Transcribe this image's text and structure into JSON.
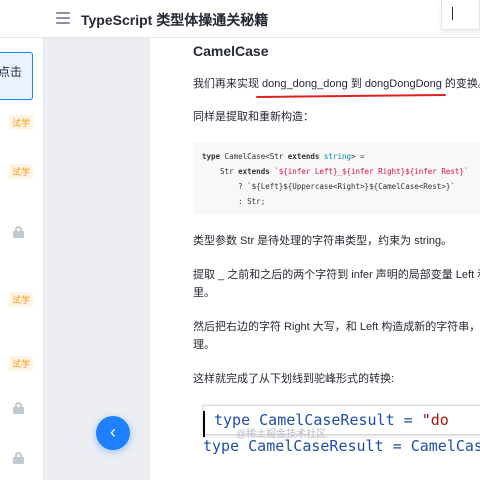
{
  "header": {
    "title": "TypeScript 类型体操通关秘籍"
  },
  "sidebar": {
    "active_item_label": "可点击",
    "badges": [
      "试学",
      "试学",
      "试学",
      "试学"
    ]
  },
  "article": {
    "heading": "CamelCase",
    "para1": "我们再来实现 dong_dong_dong 到 dongDongDong 的变换。",
    "para2": "同样是提取和重新构造：",
    "code_lines": {
      "l1_kw": "type",
      "l1_rest": " CamelCase<Str ",
      "l1_kw2": "extends",
      "l1_ty": " string",
      "l1_end": "> =",
      "l2_pre": "    Str ",
      "l2_kw": "extends",
      "l2_str": " `${infer Left}_${infer Right}${infer Rest}`",
      "l3": "        ? `${Left}${Uppercase<Right>}${CamelCase<Rest>}`",
      "l4": "        : Str;"
    },
    "para3": "类型参数 Str 是待处理的字符串类型，约束为 string。",
    "para4a": "提取 _ 之前和之后的两个字符到 infer 声明的局部变量 Left 和",
    "para4b": "里。",
    "para5a": "然后把右边的字符 Right 大写，和 Left 构造成新的字符串，剩",
    "para5b": "理。",
    "para6": "这样就完成了从下划线到驼峰形式的转换:",
    "big_code": {
      "line1_kw": "type",
      "line1_id": " CamelCaseResult = ",
      "line1_str": "\"do",
      "line2_kw": "type",
      "line2_id": " CamelCaseResult = CamelCase<"
    }
  },
  "watermark": "@稀土掘金技术社区",
  "colors": {
    "accent": "#1e80ff",
    "underline": "#e02020",
    "badge": "#f7a01a"
  }
}
